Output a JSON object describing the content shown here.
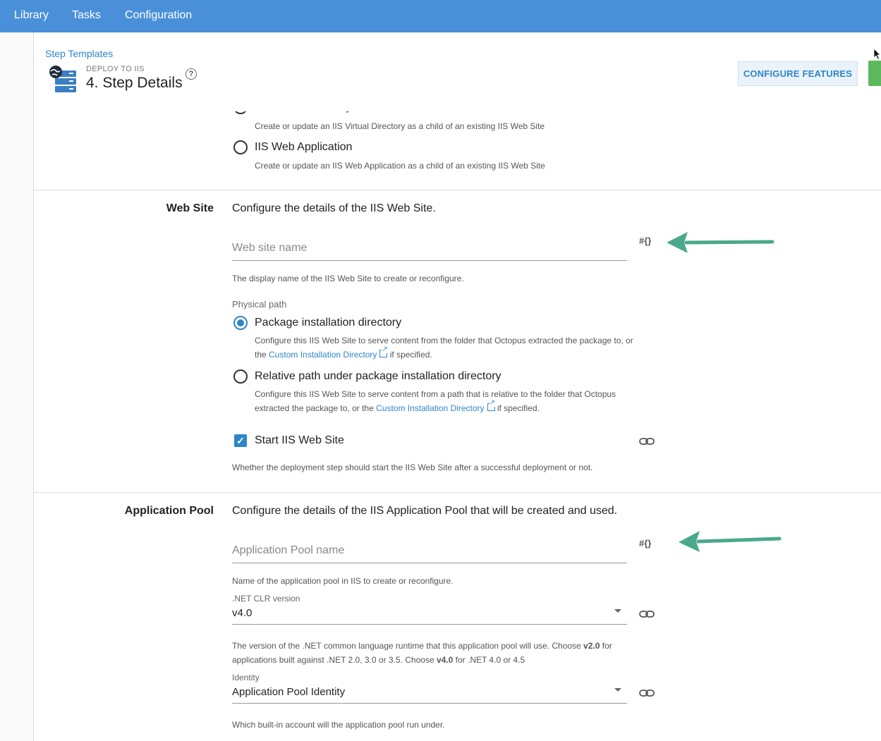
{
  "topnav": {
    "items": [
      "Library",
      "Tasks",
      "Configuration"
    ]
  },
  "header": {
    "breadcrumb": "Step Templates",
    "eyebrow": "DEPLOY TO IIS",
    "title": "4.  Step Details",
    "help_icon": "question-circle-icon",
    "configure_button": "CONFIGURE FEATURES"
  },
  "deployment_type": {
    "partial_option_label": "IIS Virtual Directory",
    "partial_option_desc": "Create or update an IIS Virtual Directory as a child of an existing IIS Web Site",
    "web_app_label": "IIS Web Application",
    "web_app_desc": "Create or update an IIS Web Application as a child of an existing IIS Web Site"
  },
  "web_site": {
    "section_label": "Web Site",
    "section_desc": "Configure the details of the IIS Web Site.",
    "name_placeholder": "Web site name",
    "name_help": "The display name of the IIS Web Site to create or reconfigure.",
    "variable_icon_text": "#{}",
    "physical_path_label": "Physical path",
    "option1_label": "Package installation directory",
    "option1_desc_a": "Configure this IIS Web Site to serve content from the folder that Octopus extracted the package to, or",
    "option1_desc_b_pre": "the ",
    "option1_desc_link": "Custom Installation Directory",
    "option1_desc_b_post": " if specified.",
    "option2_label": "Relative path under package installation directory",
    "option2_desc_a": "Configure this IIS Web Site to serve content from a path that is relative to the folder that Octopus",
    "option2_desc_b_pre": "extracted the package to, or the ",
    "option2_desc_link": "Custom Installation Directory",
    "option2_desc_b_post": " if specified.",
    "start_label": "Start IIS Web Site",
    "start_checked": true,
    "start_help": "Whether the deployment step should start the IIS Web Site after a successful deployment or not."
  },
  "app_pool": {
    "section_label": "Application Pool",
    "section_desc": "Configure the details of the IIS Application Pool that will be created and used.",
    "name_placeholder": "Application Pool name",
    "name_help": "Name of the application pool in IIS to create or reconfigure.",
    "variable_icon_text": "#{}",
    "clr_label": ".NET CLR version",
    "clr_value": "v4.0",
    "clr_help_a": "The version of the .NET common language runtime that this application pool will use. Choose ",
    "clr_help_b1": "v2.0",
    "clr_help_a2": " for",
    "clr_help_c": "applications built against .NET 2.0, 3.0 or 3.5. Choose ",
    "clr_help_b2": "v4.0",
    "clr_help_d": " for .NET 4.0 or 4.5",
    "identity_label": "Identity",
    "identity_value": "Application Pool Identity",
    "identity_help": "Which built-in account will the application pool run under."
  },
  "colors": {
    "nav": "#4a90d9",
    "accent": "#2e86c9",
    "arrow": "#4aa98b",
    "green_button": "#5cb85c"
  }
}
